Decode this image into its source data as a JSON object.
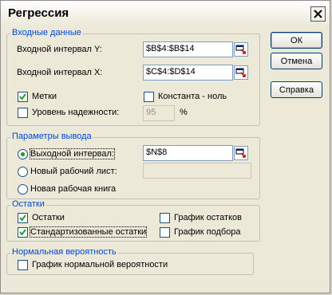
{
  "dialog": {
    "title": "Регрессия"
  },
  "input_group": {
    "legend": "Входные данные",
    "y_label": "Входной интервал Y:",
    "y_value": "$B$4:$B$14",
    "x_label": "Входной интервал X:",
    "x_value": "$C$4:$D$14",
    "labels_checkbox": {
      "label": "Метки",
      "checked": true
    },
    "constant_checkbox": {
      "label": "Константа - ноль",
      "checked": false
    },
    "confidence_checkbox": {
      "label": "Уровень надежности:",
      "checked": false
    },
    "confidence_value": "95",
    "percent": "%"
  },
  "output_group": {
    "legend": "Параметры вывода",
    "output_range": {
      "label": "Выходной интервал:",
      "value": "$N$8",
      "selected": true
    },
    "new_sheet": {
      "label": "Новый рабочий лист:",
      "value": "",
      "selected": false
    },
    "new_workbook": {
      "label": "Новая рабочая книга",
      "selected": false
    }
  },
  "residuals_group": {
    "legend": "Остатки",
    "residuals": {
      "label": "Остатки",
      "checked": true
    },
    "std_residuals": {
      "label": "Стандартизованные остатки",
      "checked": true
    },
    "residual_plot": {
      "label": "График остатков",
      "checked": false
    },
    "line_fit_plot": {
      "label": "График подбора",
      "checked": false
    }
  },
  "normal_group": {
    "legend": "Нормальная вероятность",
    "normal_plot": {
      "label": "График нормальной вероятности",
      "checked": false
    }
  },
  "buttons": {
    "ok": "ОК",
    "cancel": "Отмена",
    "help": "Справка"
  },
  "icons": {
    "close": "close-icon",
    "collapse": "collapse-dialog-icon",
    "check": "checkmark-icon"
  }
}
